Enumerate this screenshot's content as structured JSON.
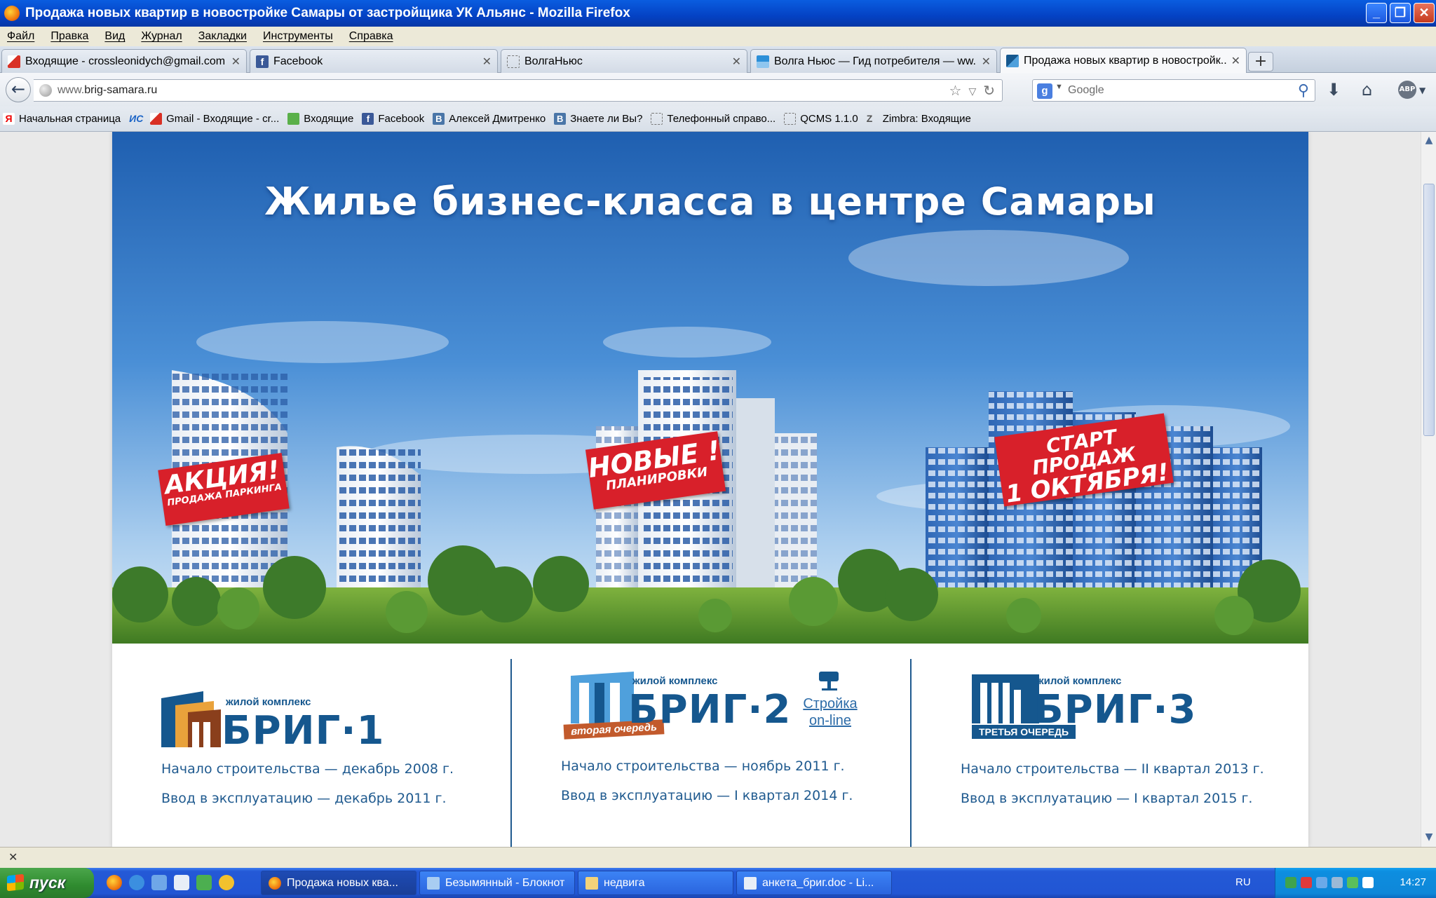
{
  "window": {
    "title": "Продажа новых квартир в новостройке Самары от застройщика УК Альянс - Mozilla Firefox"
  },
  "menu": [
    "Файл",
    "Правка",
    "Вид",
    "Журнал",
    "Закладки",
    "Инструменты",
    "Справка"
  ],
  "tabs": [
    {
      "label": "Входящие - crossleonidych@gmail.com -...",
      "icon": "gmail-icon",
      "active": false
    },
    {
      "label": "Facebook",
      "icon": "facebook-icon",
      "active": false
    },
    {
      "label": "ВолгаНьюс",
      "icon": "page-icon",
      "active": false
    },
    {
      "label": "Волга Ньюс — Гид потребителя — ww...",
      "icon": "volga-icon",
      "active": false
    },
    {
      "label": "Продажа новых квартир в новостройк...",
      "icon": "brig-icon",
      "active": true
    }
  ],
  "nav": {
    "url_host": "www.",
    "url_domain": "brig-samara.ru",
    "search_placeholder": "Google"
  },
  "bookmarks": [
    {
      "label": "Начальная страница",
      "icon": "yandex-icon"
    },
    {
      "label": "",
      "icon": "ic-icon"
    },
    {
      "label": "Gmail - Входящие - cr...",
      "icon": "gmail-icon"
    },
    {
      "label": "Входящие",
      "icon": "inbox-icon"
    },
    {
      "label": "Facebook",
      "icon": "facebook-icon"
    },
    {
      "label": "Алексей Дмитренко",
      "icon": "vk-icon"
    },
    {
      "label": "Знаете ли Вы?",
      "icon": "vk-icon"
    },
    {
      "label": "Телефонный справо...",
      "icon": "page-icon"
    },
    {
      "label": "QCMS 1.1.0",
      "icon": "page-icon"
    },
    {
      "label": "Zimbra: Входящие",
      "icon": "zimbra-icon"
    }
  ],
  "hero": {
    "title": "Жилье бизнес-класса в центре Самары",
    "promos": [
      {
        "main": "АКЦИЯ!",
        "sub": "ПРОДАЖА ПАРКИНГА"
      },
      {
        "main": "НОВЫЕ !",
        "sub": "ПЛАНИРОВКИ"
      },
      {
        "main": "СТАРТ ПРОДАЖ",
        "sub": "1 ОКТЯБРЯ!"
      }
    ]
  },
  "projects": [
    {
      "kind": "жилой комплекс",
      "name": "БРИГ·1",
      "ribbon": "",
      "start": "Начало строительства — декабрь 2008 г.",
      "finish": "Ввод в эксплуатацию — декабрь 2011 г."
    },
    {
      "kind": "жилой комплекс",
      "name": "БРИГ·2",
      "ribbon": "вторая очередь",
      "online_top": "Стройка",
      "online_bottom": "on-line",
      "start": "Начало строительства — ноябрь 2011 г.",
      "finish": "Ввод в эксплуатацию — I квартал 2014 г."
    },
    {
      "kind": "жилой комплекс",
      "name": "БРИГ·3",
      "ribbon": "ТРЕТЬЯ ОЧЕРЕДЬ",
      "start": "Начало строительства — II квартал 2013 г.",
      "finish": "Ввод в эксплуатацию — I квартал 2015 г."
    }
  ],
  "taskbar": {
    "start_label": "пуск",
    "tasks": [
      {
        "label": "Продажа новых ква...",
        "icon": "firefox-icon",
        "active": true
      },
      {
        "label": "Безымянный - Блокнот",
        "icon": "notepad-icon",
        "active": false
      },
      {
        "label": "недвига",
        "icon": "folder-icon",
        "active": false
      },
      {
        "label": "анкета_бриг.doc - Li...",
        "icon": "document-icon",
        "active": false
      }
    ],
    "lang": "RU",
    "clock": "14:27"
  },
  "colors": {
    "brand_blue": "#15578e",
    "promo_red": "#d8202a",
    "xp_blue": "#2156d4"
  }
}
